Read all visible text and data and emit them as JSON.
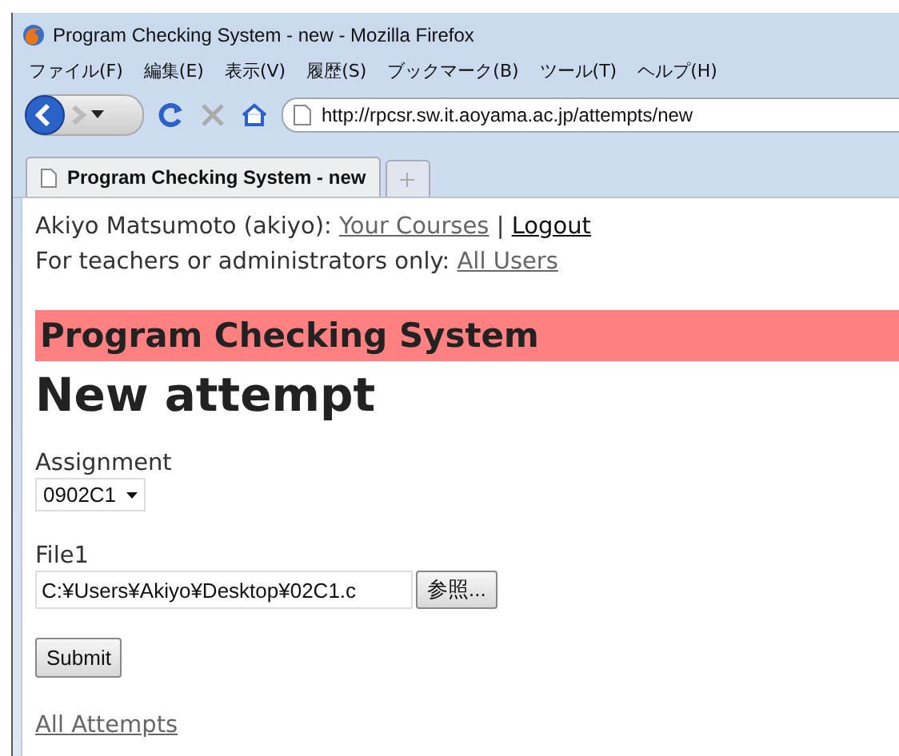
{
  "window": {
    "title": "Program Checking System - new - Mozilla Firefox"
  },
  "menu": [
    "ファイル(F)",
    "編集(E)",
    "表示(V)",
    "履歴(S)",
    "ブックマーク(B)",
    "ツール(T)",
    "ヘルプ(H)"
  ],
  "address": {
    "value": "http://rpcsr.sw.it.aoyama.ac.jp/attempts/new"
  },
  "tabs": [
    {
      "label": "Program Checking System - new",
      "selected": true
    }
  ],
  "user_line": {
    "text": "Akiyo Matsumoto (akiyo):",
    "links": [
      {
        "label": "Your Courses",
        "visited": true
      },
      {
        "label": "Logout",
        "visited": false
      }
    ],
    "separator": "|"
  },
  "admin_line": {
    "text": "For teachers or administrators only:",
    "link": {
      "label": "All Users",
      "visited": true
    }
  },
  "banner": "Program Checking System",
  "heading": "New attempt",
  "form": {
    "assignment": {
      "label": "Assignment",
      "value": "0902C1"
    },
    "file": {
      "label": "File1",
      "value": "C:¥Users¥Akiyo¥Desktop¥02C1.c",
      "browse": "参照..."
    },
    "submit": "Submit"
  },
  "footer_link": {
    "label": "All Attempts",
    "visited": true
  }
}
